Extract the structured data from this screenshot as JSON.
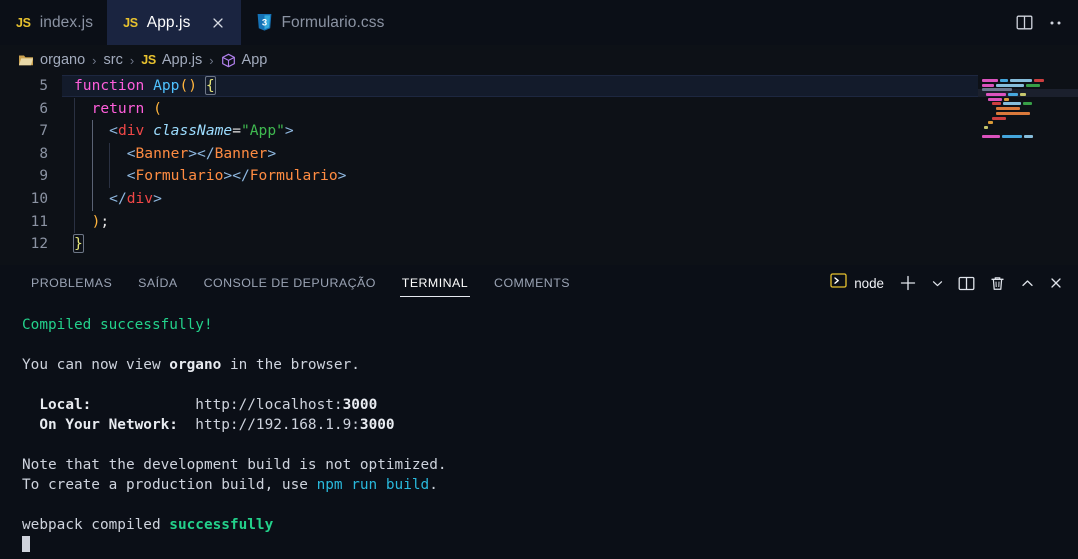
{
  "editor_tabs": [
    {
      "label": "index.js",
      "icon": "js-icon",
      "active": false,
      "closable": false
    },
    {
      "label": "App.js",
      "icon": "js-icon",
      "active": true,
      "closable": true
    },
    {
      "label": "Formulario.css",
      "icon": "css-icon",
      "active": false,
      "closable": false
    }
  ],
  "tabbar_actions": [
    {
      "name": "split-editor-icon",
      "label": ""
    },
    {
      "name": "more-actions-icon",
      "label": "…"
    }
  ],
  "breadcrumb": {
    "items": [
      {
        "label": "organo",
        "icon": "folder-icon"
      },
      {
        "label": "src",
        "icon": ""
      },
      {
        "label": "App.js",
        "icon": "js-icon"
      },
      {
        "label": "App",
        "icon": "symbol-cube-icon"
      }
    ],
    "separator": "›"
  },
  "code": {
    "language": "javascriptreact",
    "lines": [
      {
        "number": "5",
        "text": "function App() {"
      },
      {
        "number": "6",
        "text": "  return ("
      },
      {
        "number": "7",
        "text": "    <div className=\"App\">"
      },
      {
        "number": "8",
        "text": "      <Banner></Banner>"
      },
      {
        "number": "9",
        "text": "      <Formulario></Formulario>"
      },
      {
        "number": "10",
        "text": "    </div>"
      },
      {
        "number": "11",
        "text": "  );"
      },
      {
        "number": "12",
        "text": "}"
      }
    ],
    "tokens": {
      "l5": {
        "kw": "function",
        "fn": "App",
        "paren": "()",
        "brace": "{"
      },
      "l6": {
        "kw": "return",
        "paren": "("
      },
      "l7": {
        "open": "<",
        "tag": "div",
        "attr": "className",
        "eq": "=",
        "str": "\"App\"",
        "close": ">"
      },
      "l8": {
        "open": "<",
        "comp": "Banner",
        "close": ">",
        "open2": "</",
        "comp2": "Banner",
        "close2": ">"
      },
      "l9": {
        "open": "<",
        "comp": "Formulario",
        "close": ">",
        "open2": "</",
        "comp2": "Formulario",
        "close2": ">"
      },
      "l10": {
        "open": "</",
        "tag": "div",
        "close": ">"
      },
      "l11": {
        "paren": ")",
        "semi": ";"
      },
      "l12": {
        "brace": "}"
      }
    }
  },
  "panel": {
    "tabs": [
      {
        "label": "PROBLEMAS",
        "active": false
      },
      {
        "label": "SAÍDA",
        "active": false
      },
      {
        "label": "CONSOLE DE DEPURAÇÃO",
        "active": false
      },
      {
        "label": "TERMINAL",
        "active": true
      },
      {
        "label": "COMMENTS",
        "active": false
      }
    ],
    "actions": {
      "terminal_name": "node",
      "new_terminal": "+",
      "dropdown": "⌄",
      "split_terminal": "split-terminal-icon",
      "kill_terminal": "trash-icon",
      "maximize": "⌃",
      "close": "✕"
    }
  },
  "terminal_output": {
    "line1": "Compiled successfully!",
    "line2_pre": "You can now view ",
    "line2_app": "organo",
    "line2_post": " in the browser.",
    "local_label": "Local:",
    "local_url_pre": "http://localhost:",
    "local_url_port": "3000",
    "network_label": "On Your Network:",
    "network_url_pre": "http://192.168.1.9:",
    "network_url_port": "3000",
    "note1": "Note that the development build is not optimized.",
    "note2_pre": "To create a production build, use ",
    "note2_cmd": "npm run build",
    "note2_post": ".",
    "webpack_pre": "webpack compiled ",
    "webpack_status": "successfully"
  },
  "colors": {
    "editor_bg": "#0d1117",
    "tabbar_bg": "#0b0f17",
    "active_tab_bg": "#1a2440",
    "success_green": "#23d18b",
    "link_cyan": "#29b8db",
    "js_yellow": "#e8c22e",
    "css_blue": "#1572b6"
  }
}
